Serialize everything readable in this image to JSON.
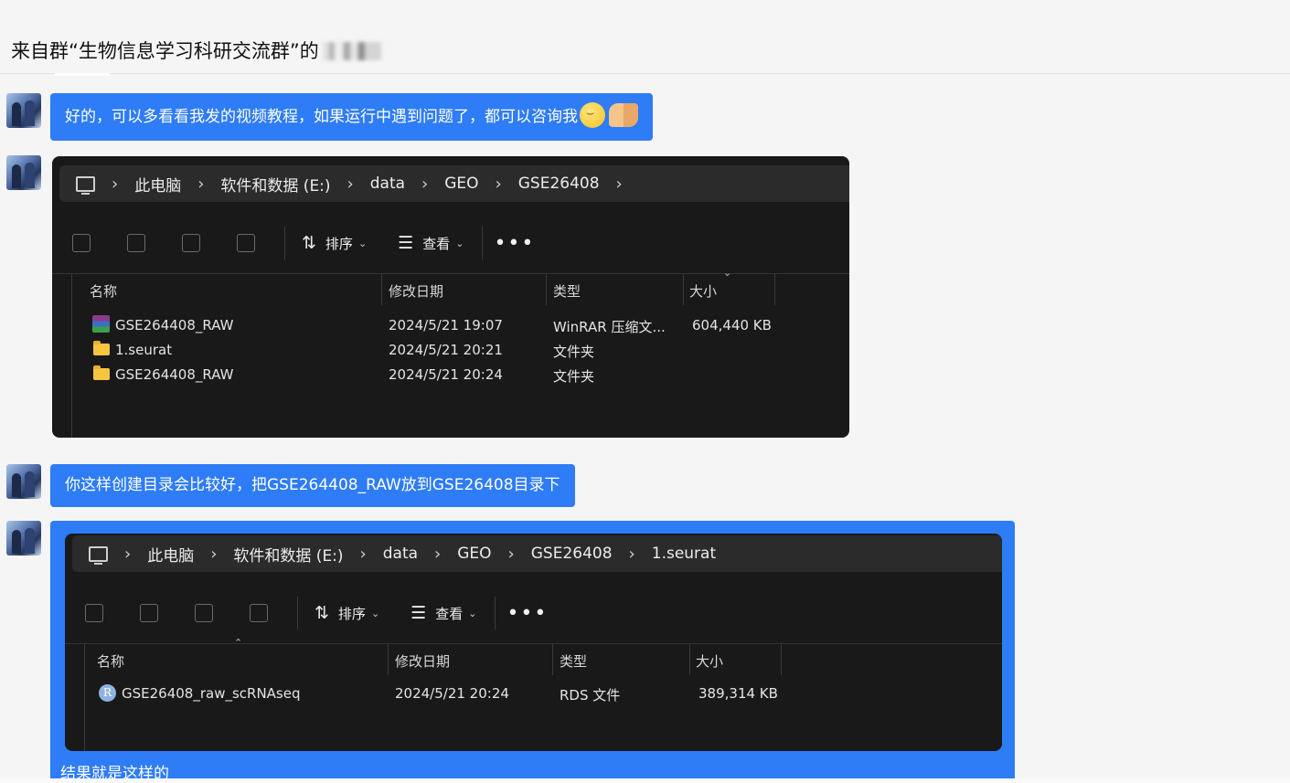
{
  "header": {
    "title": "来自群“生物信息学习科研交流群”的"
  },
  "messages": {
    "m1": {
      "text": "好的，可以多看看我发的视频教程，如果运行中遇到问题了，都可以咨询我"
    },
    "m2": {
      "text": "你这样创建目录会比较好，把GSE264408_RAW放到GSE26408目录下"
    },
    "m3": {
      "caption": "结果就是这样的"
    }
  },
  "explorer1": {
    "breadcrumb": [
      "此电脑",
      "软件和数据 (E:)",
      "data",
      "GEO",
      "GSE26408"
    ],
    "toolbar": {
      "sort": "排序",
      "view": "查看",
      "more": "•••"
    },
    "columns": {
      "name": "名称",
      "date": "修改日期",
      "type": "类型",
      "size": "大小"
    },
    "rows": [
      {
        "name": "GSE264408_RAW",
        "date": "2024/5/21 19:07",
        "type": "WinRAR 压缩文...",
        "size": "604,440 KB",
        "icon": "rar-archive-icon"
      },
      {
        "name": "1.seurat",
        "date": "2024/5/21 20:21",
        "type": "文件夹",
        "size": "",
        "icon": "folder-icon"
      },
      {
        "name": "GSE264408_RAW",
        "date": "2024/5/21 20:24",
        "type": "文件夹",
        "size": "",
        "icon": "folder-icon"
      }
    ]
  },
  "explorer2": {
    "breadcrumb": [
      "此电脑",
      "软件和数据 (E:)",
      "data",
      "GEO",
      "GSE26408",
      "1.seurat"
    ],
    "toolbar": {
      "sort": "排序",
      "view": "查看",
      "more": "•••"
    },
    "columns": {
      "name": "名称",
      "date": "修改日期",
      "type": "类型",
      "size": "大小"
    },
    "rows": [
      {
        "name": "GSE26408_raw_scRNAseq",
        "date": "2024/5/21 20:24",
        "type": "RDS 文件",
        "size": "389,314 KB",
        "icon": "rds-file-icon"
      }
    ]
  },
  "colors": {
    "bubble": "#2e7cf6",
    "explorer_bg": "#191919",
    "folder": "#f5c542"
  }
}
